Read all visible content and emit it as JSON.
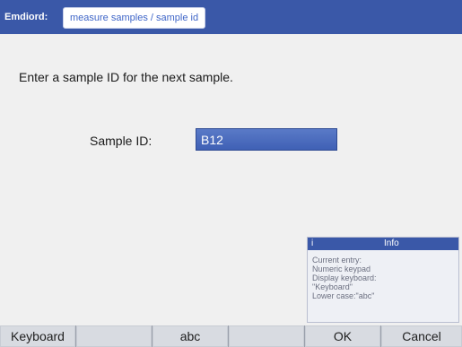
{
  "header": {
    "app_name": "Emdiord:",
    "breadcrumb": "measure samples / sample id"
  },
  "main": {
    "prompt": "Enter a sample ID for the next sample.",
    "field_label": "Sample ID:",
    "sample_id_value": "B12"
  },
  "info_panel": {
    "marker": "i",
    "title": "Info",
    "lines": [
      "Current entry:",
      "Numeric keypad",
      "Display keyboard:",
      "\"Keyboard\"",
      "Lower case:\"abc\""
    ]
  },
  "softkeys": {
    "keyboard": "Keyboard",
    "empty1": "",
    "abc": "abc",
    "empty2": "",
    "ok": "OK",
    "cancel": "Cancel"
  },
  "colors": {
    "title_bar": "#3a58a8",
    "input_highlight": "#4d6ec0",
    "softkey_bar": "#9aa0ab"
  }
}
